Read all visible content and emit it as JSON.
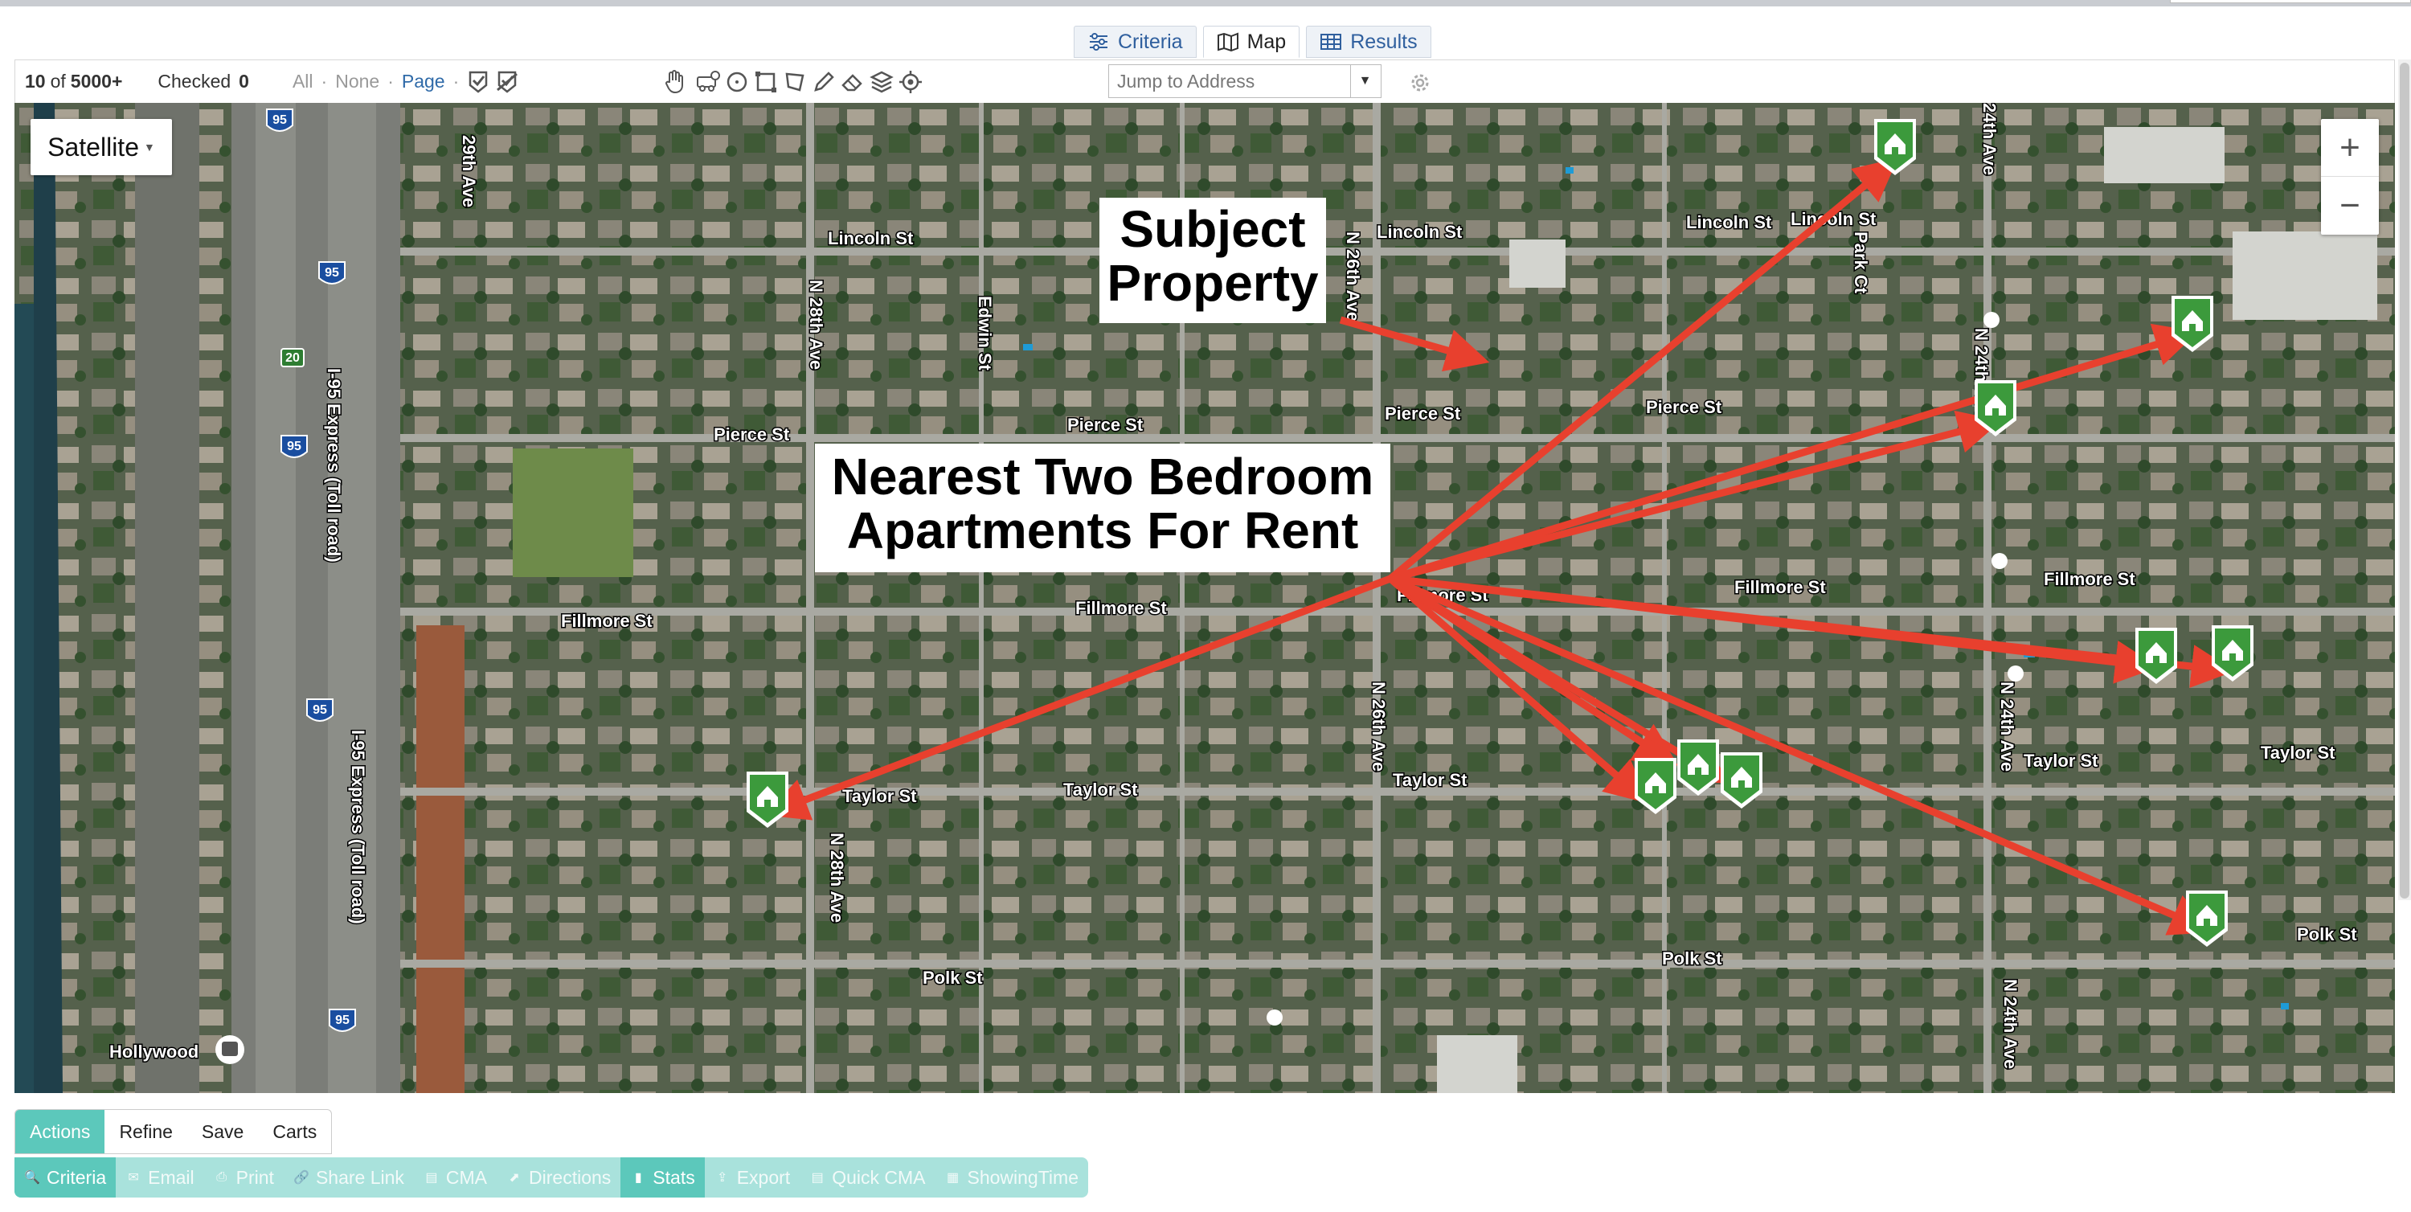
{
  "view_tabs": [
    {
      "label": "Criteria",
      "icon": "sliders-icon",
      "active": false
    },
    {
      "label": "Map",
      "icon": "map-icon",
      "active": true
    },
    {
      "label": "Results",
      "icon": "table-icon",
      "active": false
    }
  ],
  "toolbar": {
    "count": "10",
    "of": "of",
    "total": "5000+",
    "checked_label": "Checked",
    "checked_value": "0",
    "select_all": "All",
    "select_none": "None",
    "select_page": "Page",
    "address_placeholder": "Jump to Address"
  },
  "map": {
    "type_label": "Satellite",
    "zoom_in": "+",
    "zoom_out": "−",
    "annotation_subject": "Subject Property",
    "annotation_nearest": "Nearest Two Bedroom Apartments For Rent",
    "street_labels": [
      "Lincoln St",
      "Lincoln St",
      "Lincoln St",
      "Lincoln St",
      "Pierce St",
      "Pierce St",
      "Pierce St",
      "Pierce St",
      "Fillmore St",
      "Fillmore St",
      "Fillmore St",
      "Fillmore St",
      "Fillmore St",
      "Taylor St",
      "Taylor St",
      "Taylor St",
      "Taylor St",
      "Taylor St",
      "Polk St",
      "Polk St",
      "Polk St",
      "N 28th Ave",
      "N 28th Ave",
      "N 26th Ave",
      "N 26th Ave",
      "N 24th Ave",
      "N 24th Ave",
      "N 24th Ave",
      "Edwin St",
      "Park Ct",
      "29th Ave",
      "24th Ave",
      "I-95 Express (Toll road)",
      "I-95 Express (Toll road)",
      "Hollywood"
    ],
    "highway_shields": [
      "95",
      "95",
      "95",
      "95",
      "95",
      "20"
    ],
    "marker_count": 10,
    "accent_color": "#e8402e",
    "marker_color": "#3c9a3c"
  },
  "bottom_tabs": [
    {
      "label": "Actions",
      "active": true
    },
    {
      "label": "Refine",
      "active": false
    },
    {
      "label": "Save",
      "active": false
    },
    {
      "label": "Carts",
      "active": false
    }
  ],
  "actions": [
    {
      "label": "Criteria",
      "icon": "search-icon",
      "on": true
    },
    {
      "label": "Email",
      "icon": "email-icon",
      "on": false
    },
    {
      "label": "Print",
      "icon": "print-icon",
      "on": false
    },
    {
      "label": "Share Link",
      "icon": "link-icon",
      "on": false
    },
    {
      "label": "CMA",
      "icon": "document-icon",
      "on": false
    },
    {
      "label": "Directions",
      "icon": "directions-icon",
      "on": false
    },
    {
      "label": "Stats",
      "icon": "bar-chart-icon",
      "on": true
    },
    {
      "label": "Export",
      "icon": "export-icon",
      "on": false
    },
    {
      "label": "Quick CMA",
      "icon": "document-icon",
      "on": false
    },
    {
      "label": "ShowingTime",
      "icon": "calendar-icon",
      "on": false
    }
  ]
}
